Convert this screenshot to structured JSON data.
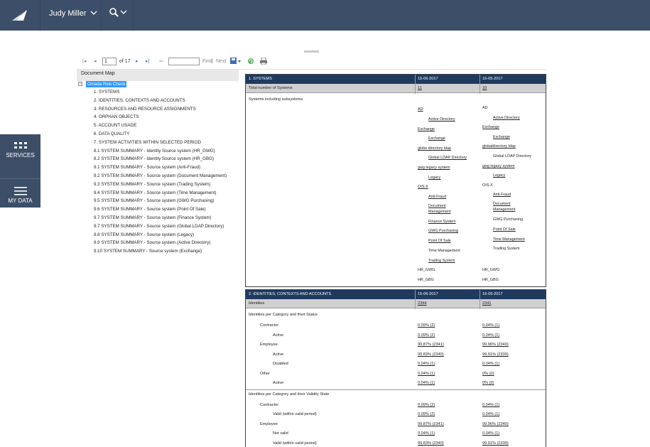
{
  "header": {
    "user_name": "Judy Miller",
    "search_icon": "search-icon",
    "logo_icon": "omada-logo-icon"
  },
  "side_panel": {
    "services_label": "SERVICES",
    "my_data_label": "MY DATA"
  },
  "toolbar": {
    "page_value": "1",
    "page_of": "of 17",
    "find_label": "Find",
    "separator": "|",
    "next_label": "Next"
  },
  "document_map": {
    "title": "Document Map",
    "root": "Omada Risk Check",
    "items": [
      "1. SYSTEMS",
      "2. IDENTITIES, CONTEXTS AND ACCOUNTS",
      "3. RESOURCES AND RESOURCE ASSIGNMENTS",
      "4. ORPHAN OBJECTS",
      "5. ACCOUNT USAGE",
      "6. DATA QUALITY",
      "7. SYSTEM ACTIVITIES WITHIN SELECTED PERIOD",
      "8.1 SYSTEM SUMMARY - Identity Source system (HR_GWG)",
      "8.2 SYSTEM SUMMARY - Identity Source system (HR_GBG)",
      "9.1 SYSTEM SUMMARY - Source system (Anti-Fraud)",
      "9.2 SYSTEM SUMMARY - Source system (Document Management)",
      "9.3 SYSTEM SUMMARY - Source system (Trading System)",
      "9.4 SYSTEM SUMMARY - Source system (Time Management)",
      "9.5 SYSTEM SUMMARY - Source system (GWG Purchasing)",
      "9.6 SYSTEM SUMMARY - Source system (Point Of Sale)",
      "9.7 SYSTEM SUMMARY - Source system (Finance System)",
      "9.7 SYSTEM SUMMARY - Source system (Global LDAP Directory)",
      "9.8 SYSTEM SUMMARY - Source system (Legacy)",
      "9.9 SYSTEM SUMMARY - Source system (Active Directory)",
      "9.10 SYSTEM SUMMARY - Source system (Exchange)"
    ]
  },
  "report": {
    "systems": {
      "title": "1. SYSTEMS",
      "date1": "15-06-2017",
      "date2": "16-05-2017",
      "total_label": "Total number of Systems",
      "total1": "11",
      "total2": "10",
      "subsystems_label": "Systems including subsystems",
      "col1": [
        "AD",
        "Active Directory",
        "Exchange",
        "Exchange",
        "globe directory ldap",
        "Global LDAP Directory",
        "gwg legacy system",
        "Legacy",
        "OIS-X",
        "Anti-Fraud",
        "Document",
        "Management",
        "Finance System",
        "GWG Purchasing",
        "Point Of Sale",
        "Time Management",
        "Trading System",
        "HR_GWG",
        "HR_GBG"
      ],
      "col2": [
        "AD",
        "Active Directory",
        "Exchange",
        "Exchange",
        "globaldirectory ldap",
        "Global LDAP Directory",
        "gwg legacy system",
        "Legacy",
        "OIS-X",
        "Anti-Fraud",
        "Document",
        "Management",
        "GWG Purchasing",
        "Point Of Sale",
        "Time Management",
        "Trading System",
        "HR_GWG",
        "HR_GBG"
      ]
    },
    "identities": {
      "title": "2. IDENTITIES, CONTEXTS AND ACCOUNTS",
      "date1": "15-06-2017",
      "date2": "16-05-2017",
      "identities_label": "Identities",
      "identities1": "2344",
      "identities2": "2341",
      "status_title": "Identities per Category and their Status",
      "status_rows": [
        {
          "label": "Contractor",
          "v1": "0.09% (2)",
          "v2": "0.04% (1)"
        },
        {
          "label": "Active",
          "v1": "0.09% (2)",
          "v2": "0.04% (1)"
        },
        {
          "label": "Employee",
          "v1": "99.87% (2341)",
          "v2": "99.96% (2340)"
        },
        {
          "label": "Active",
          "v1": "99.83% (2340)",
          "v2": "99.91% (2339)"
        },
        {
          "label": "Disabled",
          "v1": "0.04% (1)",
          "v2": "0.04% (1)"
        },
        {
          "label": "Other",
          "v1": "0.04% (1)",
          "v2": "0% (0)"
        },
        {
          "label": "Active",
          "v1": "0.04% (1)",
          "v2": "0% (0)"
        }
      ],
      "validity_title": "Identities per Category and their Validity State",
      "validity_rows": [
        {
          "label": "Contractor",
          "v1": "0.09% (2)",
          "v2": "0.04% (1)"
        },
        {
          "label": "Valid (within valid period)",
          "v1": "0.09% (2)",
          "v2": "0.04% (1)"
        },
        {
          "label": "Employee",
          "v1": "99.87% (2341)",
          "v2": "99.96% (2340)"
        },
        {
          "label": "Not valid",
          "v1": "0.04% (1)",
          "v2": "0.04% (1)"
        },
        {
          "label": "Valid (within valid period)",
          "v1": "99.83% (2340)",
          "v2": "99.91% (2339)"
        }
      ]
    }
  }
}
